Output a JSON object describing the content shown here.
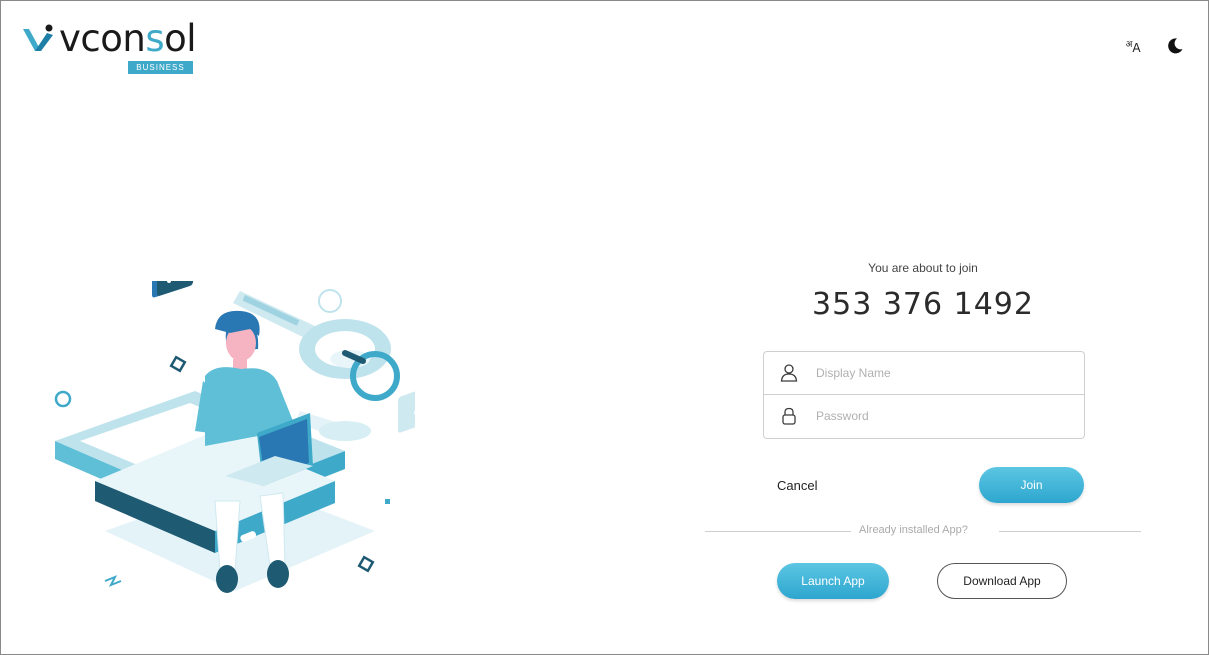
{
  "brand": {
    "word_pre": "vcon",
    "word_accent": "s",
    "word_post": "ol",
    "badge": "BUSINESS",
    "accent_color": "#3fa9c9"
  },
  "header": {
    "language_icon": "translate-icon",
    "language_glyph_sup": "अ",
    "language_glyph": "A",
    "theme_icon": "moon-icon"
  },
  "join": {
    "about_text": "You are about to join",
    "meeting_id": "353 376 1492",
    "display_name_placeholder": "Display Name",
    "password_placeholder": "Password",
    "cancel_label": "Cancel",
    "join_label": "Join",
    "divider_text": "Already installed App?",
    "launch_label": "Launch App",
    "download_label": "Download App"
  }
}
